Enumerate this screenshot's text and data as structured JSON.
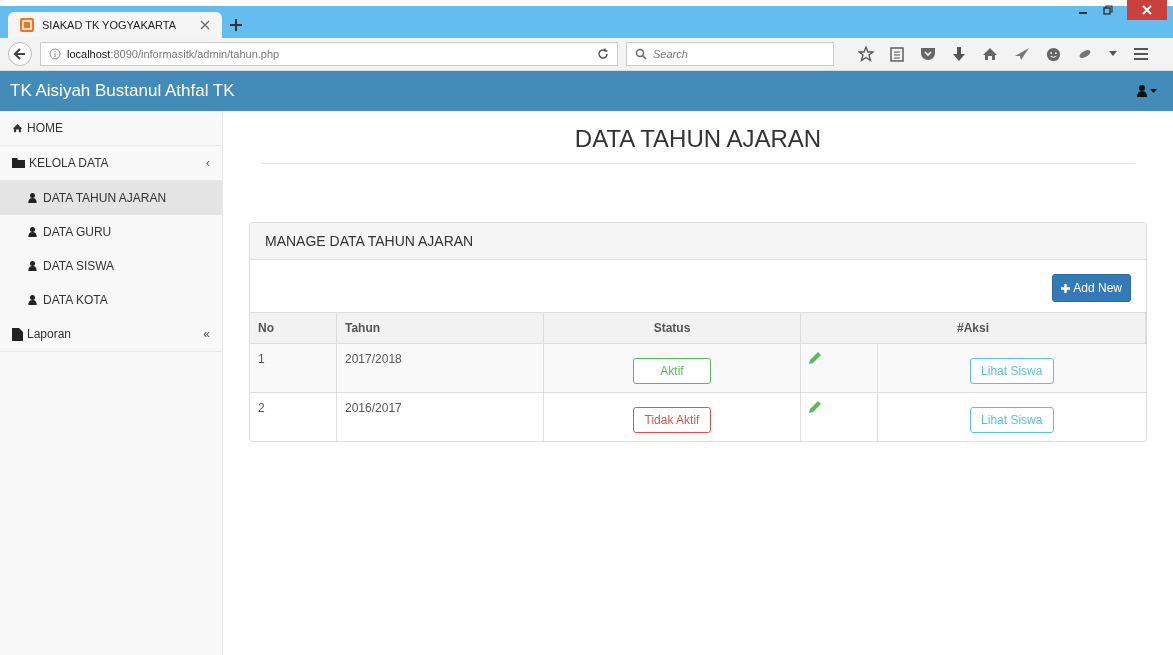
{
  "browser": {
    "tab_title": "SIAKAD TK YOGYAKARTA",
    "url_host": "localhost",
    "url_rest": ":8090/informasitk/admin/tahun.php",
    "search_placeholder": "Search"
  },
  "navbar": {
    "brand": "TK Aisiyah Bustanul Athfal TK"
  },
  "sidebar": {
    "items": [
      {
        "label": "HOME"
      },
      {
        "label": "KELOLA DATA",
        "toggle": "‹",
        "children": [
          {
            "label": "DATA TAHUN AJARAN",
            "selected": true
          },
          {
            "label": "DATA GURU",
            "selected": false
          },
          {
            "label": "DATA SISWA",
            "selected": false
          },
          {
            "label": "DATA KOTA",
            "selected": false
          }
        ]
      },
      {
        "label": "Laporan",
        "toggle": "«"
      }
    ]
  },
  "page": {
    "title": "DATA TAHUN AJARAN"
  },
  "panel": {
    "heading": "MANAGE DATA TAHUN AJARAN",
    "add_button": "Add New",
    "columns": [
      "No",
      "Tahun",
      "Status",
      "#Aksi"
    ],
    "rows": [
      {
        "no": "1",
        "tahun": "2017/2018",
        "status": "Aktif",
        "kind": "active",
        "action": "Lihat Siswa"
      },
      {
        "no": "2",
        "tahun": "2016/2017",
        "status": "Tidak Aktif",
        "kind": "inactive",
        "action": "Lihat Siswa"
      }
    ]
  }
}
